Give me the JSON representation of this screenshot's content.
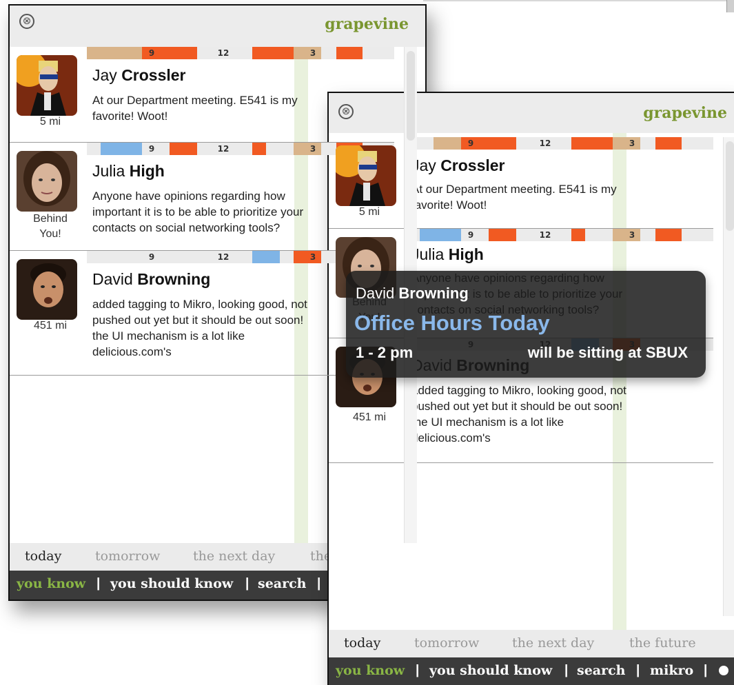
{
  "app": {
    "brand": "grapevine",
    "close_glyph": "⊗"
  },
  "timeline_labels": [
    "9",
    "12",
    "3"
  ],
  "contacts": [
    {
      "first": "Jay",
      "last": "Crossler",
      "distance": "5 mi",
      "message": "At our Department meeting. E541 is my favorite! Woot!",
      "avatar_icon": "cartoon-avatar-icon"
    },
    {
      "first": "Julia",
      "last": "High",
      "distance": "Behind You!",
      "message": "Anyone have opinions regarding how important it is to be able to prioritize your contacts on social networking tools?",
      "avatar_icon": "person-photo-icon"
    },
    {
      "first": "David",
      "last": "Browning",
      "distance": "451 mi",
      "message": "added tagging to Mikro, looking good, not pushed out yet but it should be out soon! the UI mechanism is a lot like delicious.com's",
      "avatar_icon": "person-photo-icon"
    }
  ],
  "back_window": {
    "msg_lines": [
      [
        "At our Department meeting. E541 is my",
        "favorite! Woot!"
      ],
      [
        "Anyone have opinions regarding how",
        "important it is to be able to prioritize your",
        "contacts on social networking tools?"
      ],
      [
        "added tagging to Mikro, looking good, not",
        "pushed out yet but it should be out soon!",
        "the UI mechanism is a lot like",
        "delicious.com's"
      ]
    ],
    "distance_lines": [
      "5 mi",
      "Behind\nYou!",
      "451 mi"
    ]
  },
  "day_tabs": [
    "today",
    "tomorrow",
    "the next day",
    "the future"
  ],
  "active_day": "today",
  "nav": [
    "you know",
    "you should know",
    "search",
    "mikro"
  ],
  "active_nav": "you know",
  "popup": {
    "first": "David",
    "last": "Browning",
    "title": "Office Hours Today",
    "time": "1 - 2 pm",
    "location": "will be sitting at SBUX"
  },
  "colors": {
    "brand": "#7a9630",
    "active_nav": "#8ab645",
    "busy": "#f15a22",
    "tentative": "#d9b48a",
    "free": "#7fb4e6",
    "popup_title": "#8ab8ea"
  }
}
